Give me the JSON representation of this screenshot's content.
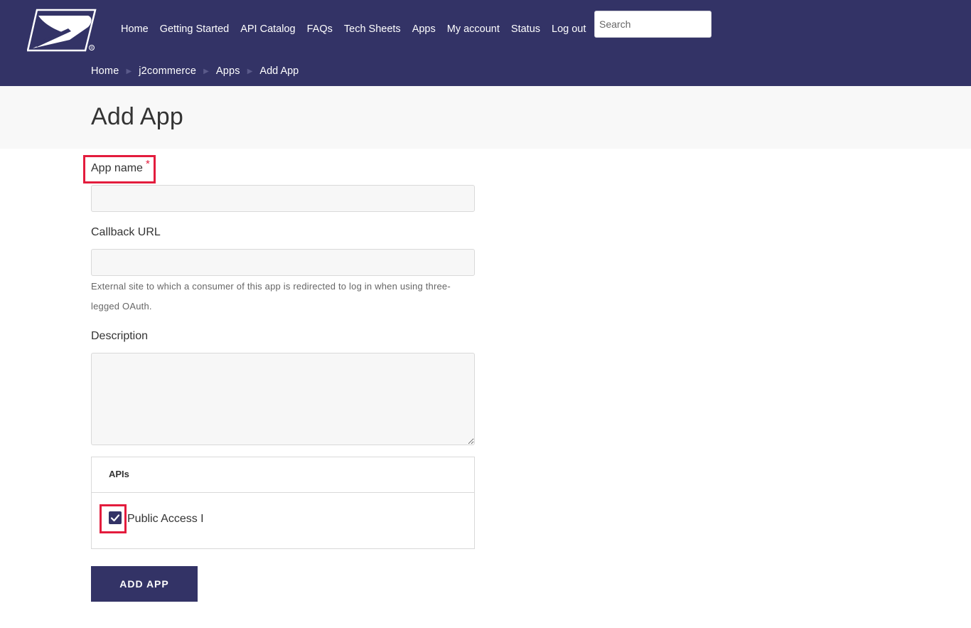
{
  "header": {
    "logo_icon": "usps-eagle-logo-icon",
    "nav": [
      "Home",
      "Getting Started",
      "API Catalog",
      "FAQs",
      "Tech Sheets",
      "Apps",
      "My account",
      "Status",
      "Log out"
    ],
    "search_placeholder": "Search"
  },
  "breadcrumb": {
    "items": [
      "Home",
      "j2commerce",
      "Apps"
    ],
    "current": "Add App"
  },
  "page_title": "Add App",
  "form": {
    "app_name_label": "App name",
    "required_marker": "*",
    "app_name_value": "",
    "callback_label": "Callback URL",
    "callback_value": "",
    "callback_help": "External site to which a consumer of this app is redirected to log in when using three-legged OAuth.",
    "description_label": "Description",
    "description_value": "",
    "apis_heading": "APIs",
    "apis": [
      {
        "label": "Public Access I",
        "checked": true
      }
    ],
    "submit_label": "ADD APP"
  },
  "colors": {
    "brand": "#333366",
    "required": "#e31c3d",
    "annotation": "#e31c3d"
  }
}
